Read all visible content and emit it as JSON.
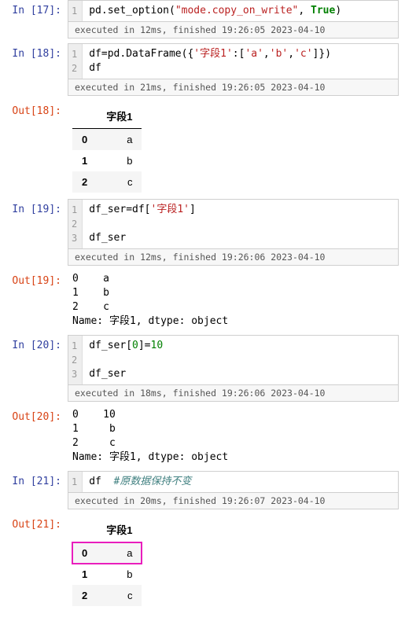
{
  "cells": {
    "c17": {
      "in_prompt": "In [17]:",
      "lines": [
        "1"
      ],
      "code_html": "pd.set_option(<span class='s-str'>\"mode.copy_on_write\"</span>, <span class='s-kw'>True</span>)",
      "exec": "executed in 12ms, finished 19:26:05 2023-04-10"
    },
    "c18": {
      "in_prompt": "In [18]:",
      "lines": [
        "1",
        "2"
      ],
      "code_html": "df=pd.DataFrame({<span class='s-str'>'字段1'</span>:[<span class='s-str'>'a'</span>,<span class='s-str'>'b'</span>,<span class='s-str'>'c'</span>]})\ndf",
      "exec": "executed in 21ms, finished 19:26:05 2023-04-10",
      "out_prompt": "Out[18]:",
      "df": {
        "col": "字段1",
        "rows": [
          [
            "0",
            "a"
          ],
          [
            "1",
            "b"
          ],
          [
            "2",
            "c"
          ]
        ]
      }
    },
    "c19": {
      "in_prompt": "In [19]:",
      "lines": [
        "1",
        "2",
        "3"
      ],
      "code_html": "df_ser=df[<span class='s-str'>'字段1'</span>]\n\ndf_ser",
      "exec": "executed in 12ms, finished 19:26:06 2023-04-10",
      "out_prompt": "Out[19]:",
      "text_out": "0    a\n1    b\n2    c\nName: 字段1, dtype: object"
    },
    "c20": {
      "in_prompt": "In [20]:",
      "lines": [
        "1",
        "2",
        "3"
      ],
      "code_html": "df_ser[<span class='s-num'>0</span>]=<span class='s-num'>10</span>\n\ndf_ser",
      "exec": "executed in 18ms, finished 19:26:06 2023-04-10",
      "out_prompt": "Out[20]:",
      "text_out": "0    10\n1     b\n2     c\nName: 字段1, dtype: object"
    },
    "c21": {
      "in_prompt": "In [21]:",
      "lines": [
        "1"
      ],
      "code_html": "df  <span class='s-cmt'>#原数据保持不变</span>",
      "exec": "executed in 20ms, finished 19:26:07 2023-04-10",
      "out_prompt": "Out[21]:",
      "df": {
        "col": "字段1",
        "rows": [
          [
            "0",
            "a"
          ],
          [
            "1",
            "b"
          ],
          [
            "2",
            "c"
          ]
        ],
        "highlight": 0
      }
    }
  }
}
